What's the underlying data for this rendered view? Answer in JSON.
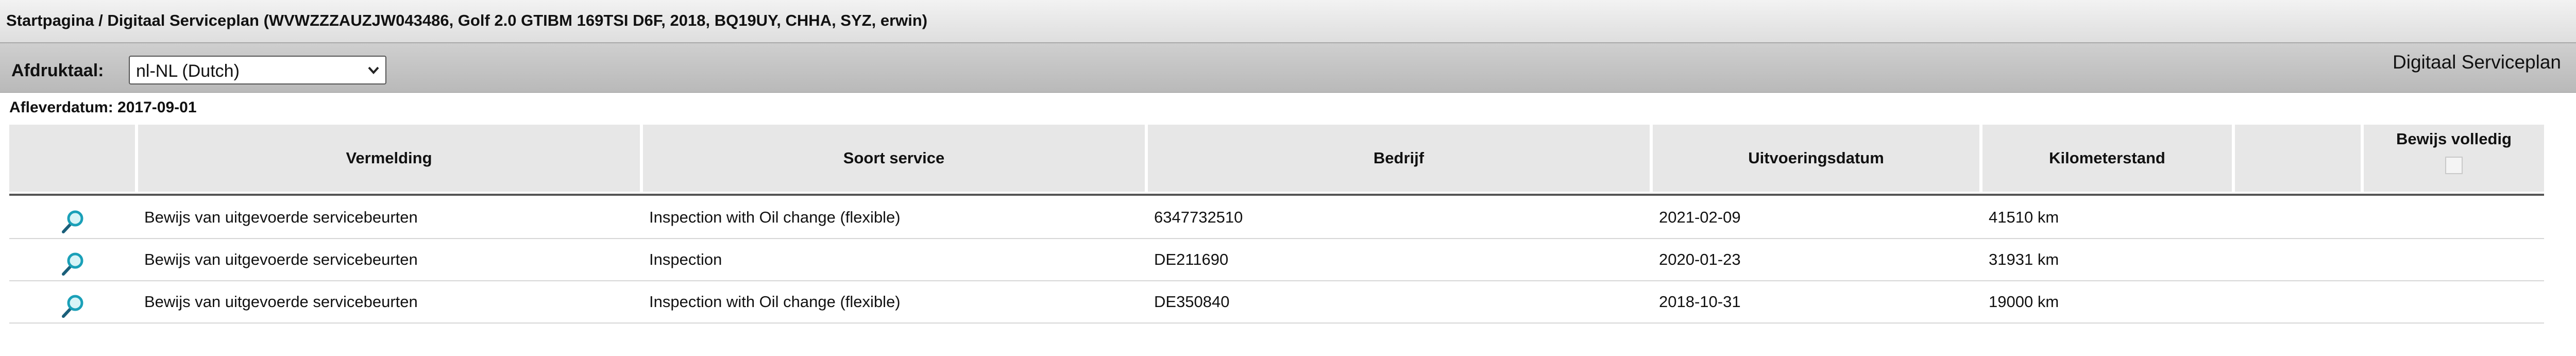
{
  "header": {
    "breadcrumb": "Startpagina / Digitaal Serviceplan (WVWZZZAUZJW043486, Golf 2.0 GTIBM 169TSI D6F, 2018, BQ19UY, CHHA, SYZ, erwin)"
  },
  "toolbar": {
    "language_label": "Afdruktaal:",
    "language_value": "nl-NL (Dutch)",
    "doc_title": "Digitaal Serviceplan"
  },
  "delivery": {
    "text": "Afleverdatum: 2017-09-01"
  },
  "table": {
    "columns": {
      "vermelding": "Vermelding",
      "soort": "Soort service",
      "bedrijf": "Bedrijf",
      "datum": "Uitvoeringsdatum",
      "km": "Kilometerstand",
      "bewijs": "Bewijs volledig"
    },
    "rows": [
      {
        "vermelding": "Bewijs van uitgevoerde servicebeurten",
        "soort": "Inspection with Oil change (flexible)",
        "bedrijf": "6347732510",
        "datum": "2021-02-09",
        "km": "41510 km"
      },
      {
        "vermelding": "Bewijs van uitgevoerde servicebeurten",
        "soort": "Inspection",
        "bedrijf": "DE211690",
        "datum": "2020-01-23",
        "km": "31931 km"
      },
      {
        "vermelding": "Bewijs van uitgevoerde servicebeurten",
        "soort": "Inspection with Oil change (flexible)",
        "bedrijf": "DE350840",
        "datum": "2018-10-31",
        "km": "19000 km"
      }
    ]
  },
  "icons": {
    "view": "magnifier-icon",
    "select_chevron": "chevron-down-icon"
  },
  "colors": {
    "header_bg": "#e7e7e7",
    "toolbar_bg": "#c4c4c4",
    "icon_accent": "#1aa0b8"
  }
}
